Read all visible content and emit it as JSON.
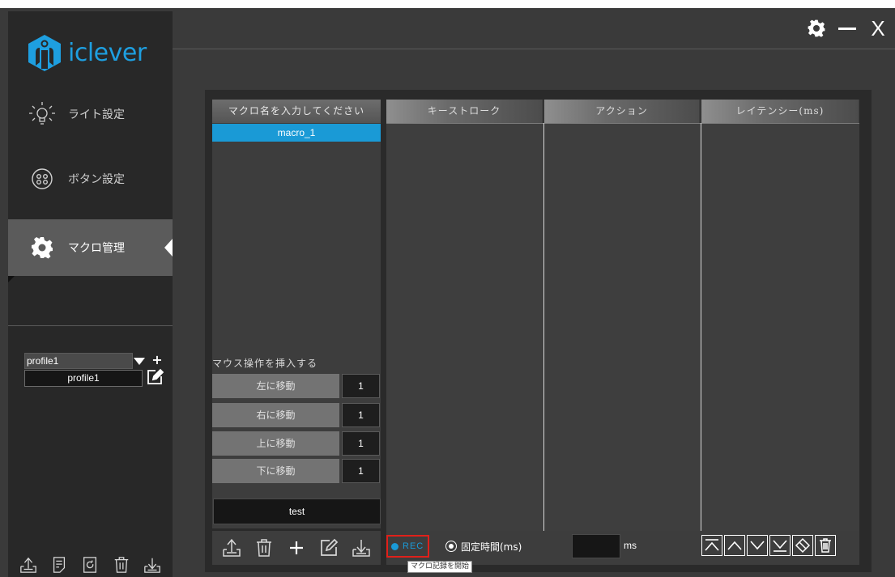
{
  "app": {
    "brand_name": "iclever",
    "brand_color": "#1e9fe0"
  },
  "window_controls": {
    "settings_icon": "gear-icon",
    "minimize_icon": "minimize-icon",
    "close_label": "X"
  },
  "sidebar": {
    "items": [
      {
        "label": "ライト設定",
        "icon": "lightbulb-icon",
        "active": false
      },
      {
        "label": "ボタン設定",
        "icon": "buttons-icon",
        "active": false
      },
      {
        "label": "マクロ管理",
        "icon": "gear-icon",
        "active": true
      }
    ],
    "profile": {
      "selected": "profile1",
      "name_value": "profile1"
    },
    "bottom_icons": [
      "upload-icon",
      "document-icon",
      "refresh-icon",
      "trash-icon",
      "download-icon"
    ]
  },
  "macro_panel": {
    "header": "マクロ名を入力してください",
    "macros": [
      "macro_1"
    ],
    "mouse_section_label": "マウス操作を挿入する",
    "moves": [
      {
        "label": "左に移動",
        "value": "1"
      },
      {
        "label": "右に移動",
        "value": "1"
      },
      {
        "label": "上に移動",
        "value": "1"
      },
      {
        "label": "下に移動",
        "value": "1"
      }
    ],
    "name_input_value": "test",
    "toolbar_icons": [
      "upload-icon",
      "trash-icon",
      "plus-icon",
      "edit-icon",
      "download-icon"
    ]
  },
  "table": {
    "columns": [
      "キーストローク",
      "アクション",
      "レイテンシー(ms)"
    ]
  },
  "record_bar": {
    "rec_label": "REC",
    "rec_tooltip": "マクロ記録を開始",
    "fixed_time_label": "固定時間(ms)",
    "ms_value": "",
    "ms_unit": "ms",
    "order_icons": [
      "move-top-icon",
      "move-up-icon",
      "move-down-icon",
      "move-bottom-icon",
      "eraser-icon",
      "trash-icon"
    ],
    "rec_border_color": "#e0201a",
    "accent_color": "#1a9ad6"
  }
}
